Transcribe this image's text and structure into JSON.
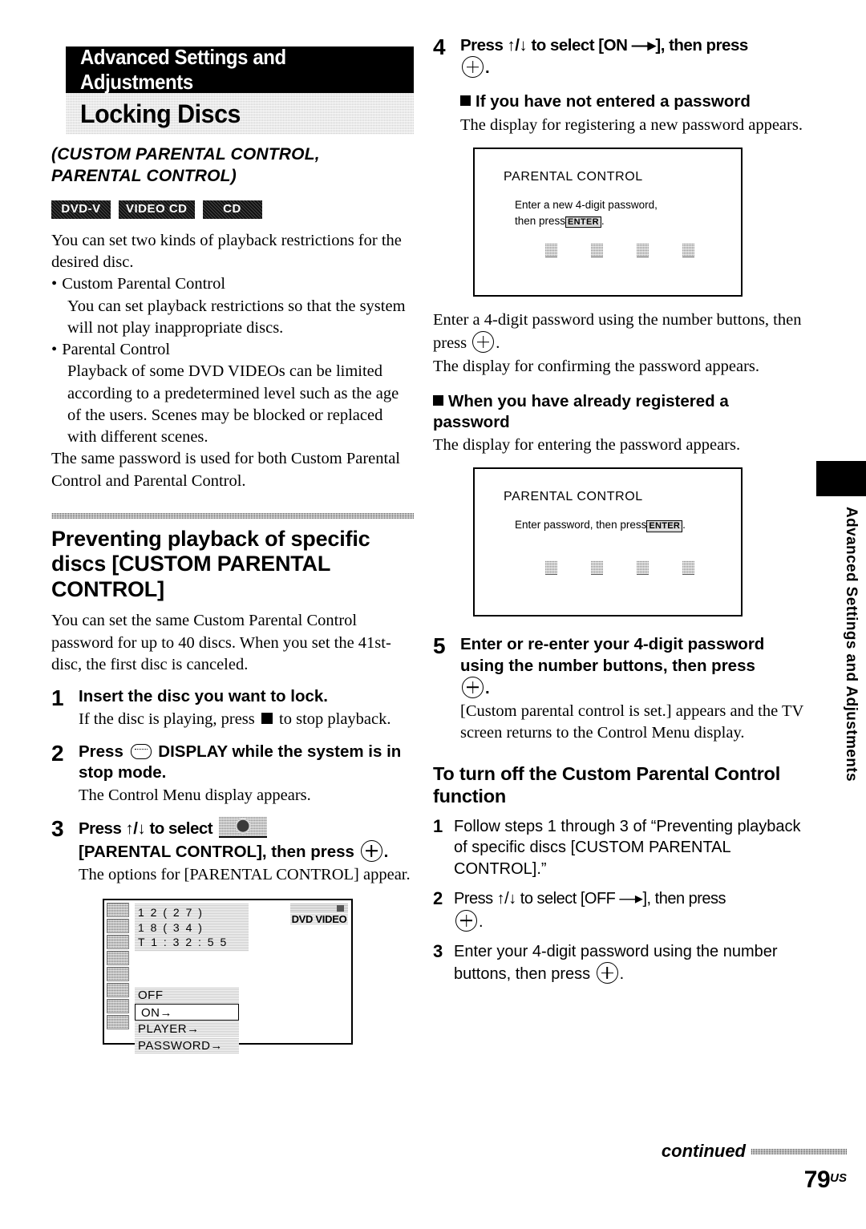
{
  "masthead": {
    "chapter_band": "Advanced Settings and Adjustments",
    "title": "Locking Discs",
    "subtitle_line1": "(CUSTOM PARENTAL CONTROL,",
    "subtitle_line2": "PARENTAL CONTROL)"
  },
  "disc_badges": [
    "DVD-V",
    "VIDEO CD",
    "CD"
  ],
  "intro": {
    "paragraph": "You can set two kinds of playback restrictions for the desired disc.",
    "bullets": [
      {
        "title": "Custom Parental Control",
        "body": "You can set playback restrictions so that the system will not play inappropriate discs."
      },
      {
        "title": "Parental Control",
        "body": "Playback of some DVD VIDEOs can be limited according to a predetermined level such as the age of the users. Scenes may be blocked or replaced with different scenes."
      }
    ],
    "closing": "The same password is used for both Custom Parental Control and Parental Control."
  },
  "section": {
    "heading": "Preventing playback of specific discs [CUSTOM PARENTAL CONTROL]",
    "intro": "You can set the same Custom Parental Control password for up to 40 discs. When you set the 41st-disc, the first disc is canceled."
  },
  "steps": {
    "step1": {
      "num": "1",
      "title": "Insert the disc you want to lock.",
      "note_before": "If the disc is playing, press",
      "note_after": "to stop playback."
    },
    "step2": {
      "num": "2",
      "title_before": "Press",
      "title_after": "DISPLAY while the system is in stop mode.",
      "note": "The Control Menu display appears."
    },
    "step3": {
      "num": "3",
      "title_before": "Press ↑/↓ to select",
      "title_after": "[PARENTAL CONTROL], then press",
      "title_end": ".",
      "note": "The options for [PARENTAL CONTROL] appear."
    },
    "step4": {
      "num": "4",
      "title_before": "Press ↑/↓ to select [ON —▸], then press",
      "title_end": "."
    },
    "step5": {
      "num": "5",
      "title_before": "Enter or re-enter your 4-digit password using the number buttons, then press",
      "title_end": ".",
      "note": "[Custom parental control is set.] appears and the TV screen returns to the Control Menu display."
    }
  },
  "subheads": {
    "no_password": {
      "heading": "If you have not entered a password",
      "body": "The display for registering a new password appears."
    },
    "already_registered": {
      "heading": "When you have already registered a password",
      "body": "The display for entering the password appears."
    }
  },
  "between_figures": {
    "enter_before": "Enter a 4-digit password using the number buttons, then press",
    "enter_end": ".",
    "confirm": "The display for confirming the password appears."
  },
  "osd_register": {
    "title": "PARENTAL CONTROL",
    "line1": "Enter a new 4-digit password,",
    "line2_before": "then press",
    "enter_key": "ENTER",
    "line2_after": ".",
    "slots": 4
  },
  "osd_enter": {
    "title": "PARENTAL CONTROL",
    "line1_before": "Enter password, then press",
    "enter_key": "ENTER",
    "line1_after": ".",
    "slots": 4
  },
  "tv_figure": {
    "info_lines": [
      "1 2 ( 2 7 )",
      "1 8 ( 3 4 )",
      "T   1 : 3 2 : 5 5"
    ],
    "disc_badge": "DVD VIDEO",
    "sidebar_cells": 8,
    "menu_items": [
      {
        "label": "OFF",
        "selected": false
      },
      {
        "label": "ON→",
        "selected": true
      },
      {
        "label": "PLAYER→",
        "selected": false
      },
      {
        "label": "PASSWORD→",
        "selected": false
      }
    ]
  },
  "turn_off": {
    "heading": "To turn off the Custom Parental Control function",
    "items": [
      {
        "num": "1",
        "text": "Follow steps 1 through 3 of “Preventing playback of specific discs [CUSTOM PARENTAL CONTROL].”"
      },
      {
        "num": "2",
        "text_before": "Press ↑/↓ to select [OFF —▸], then press",
        "text_end": "."
      },
      {
        "num": "3",
        "text_before": "Enter your 4-digit password using the number buttons, then press",
        "text_end": "."
      }
    ]
  },
  "side_tab": {
    "label": "Advanced Settings and Adjustments"
  },
  "footer": {
    "continued": "continued",
    "page_number": "79",
    "page_suffix": "US"
  }
}
